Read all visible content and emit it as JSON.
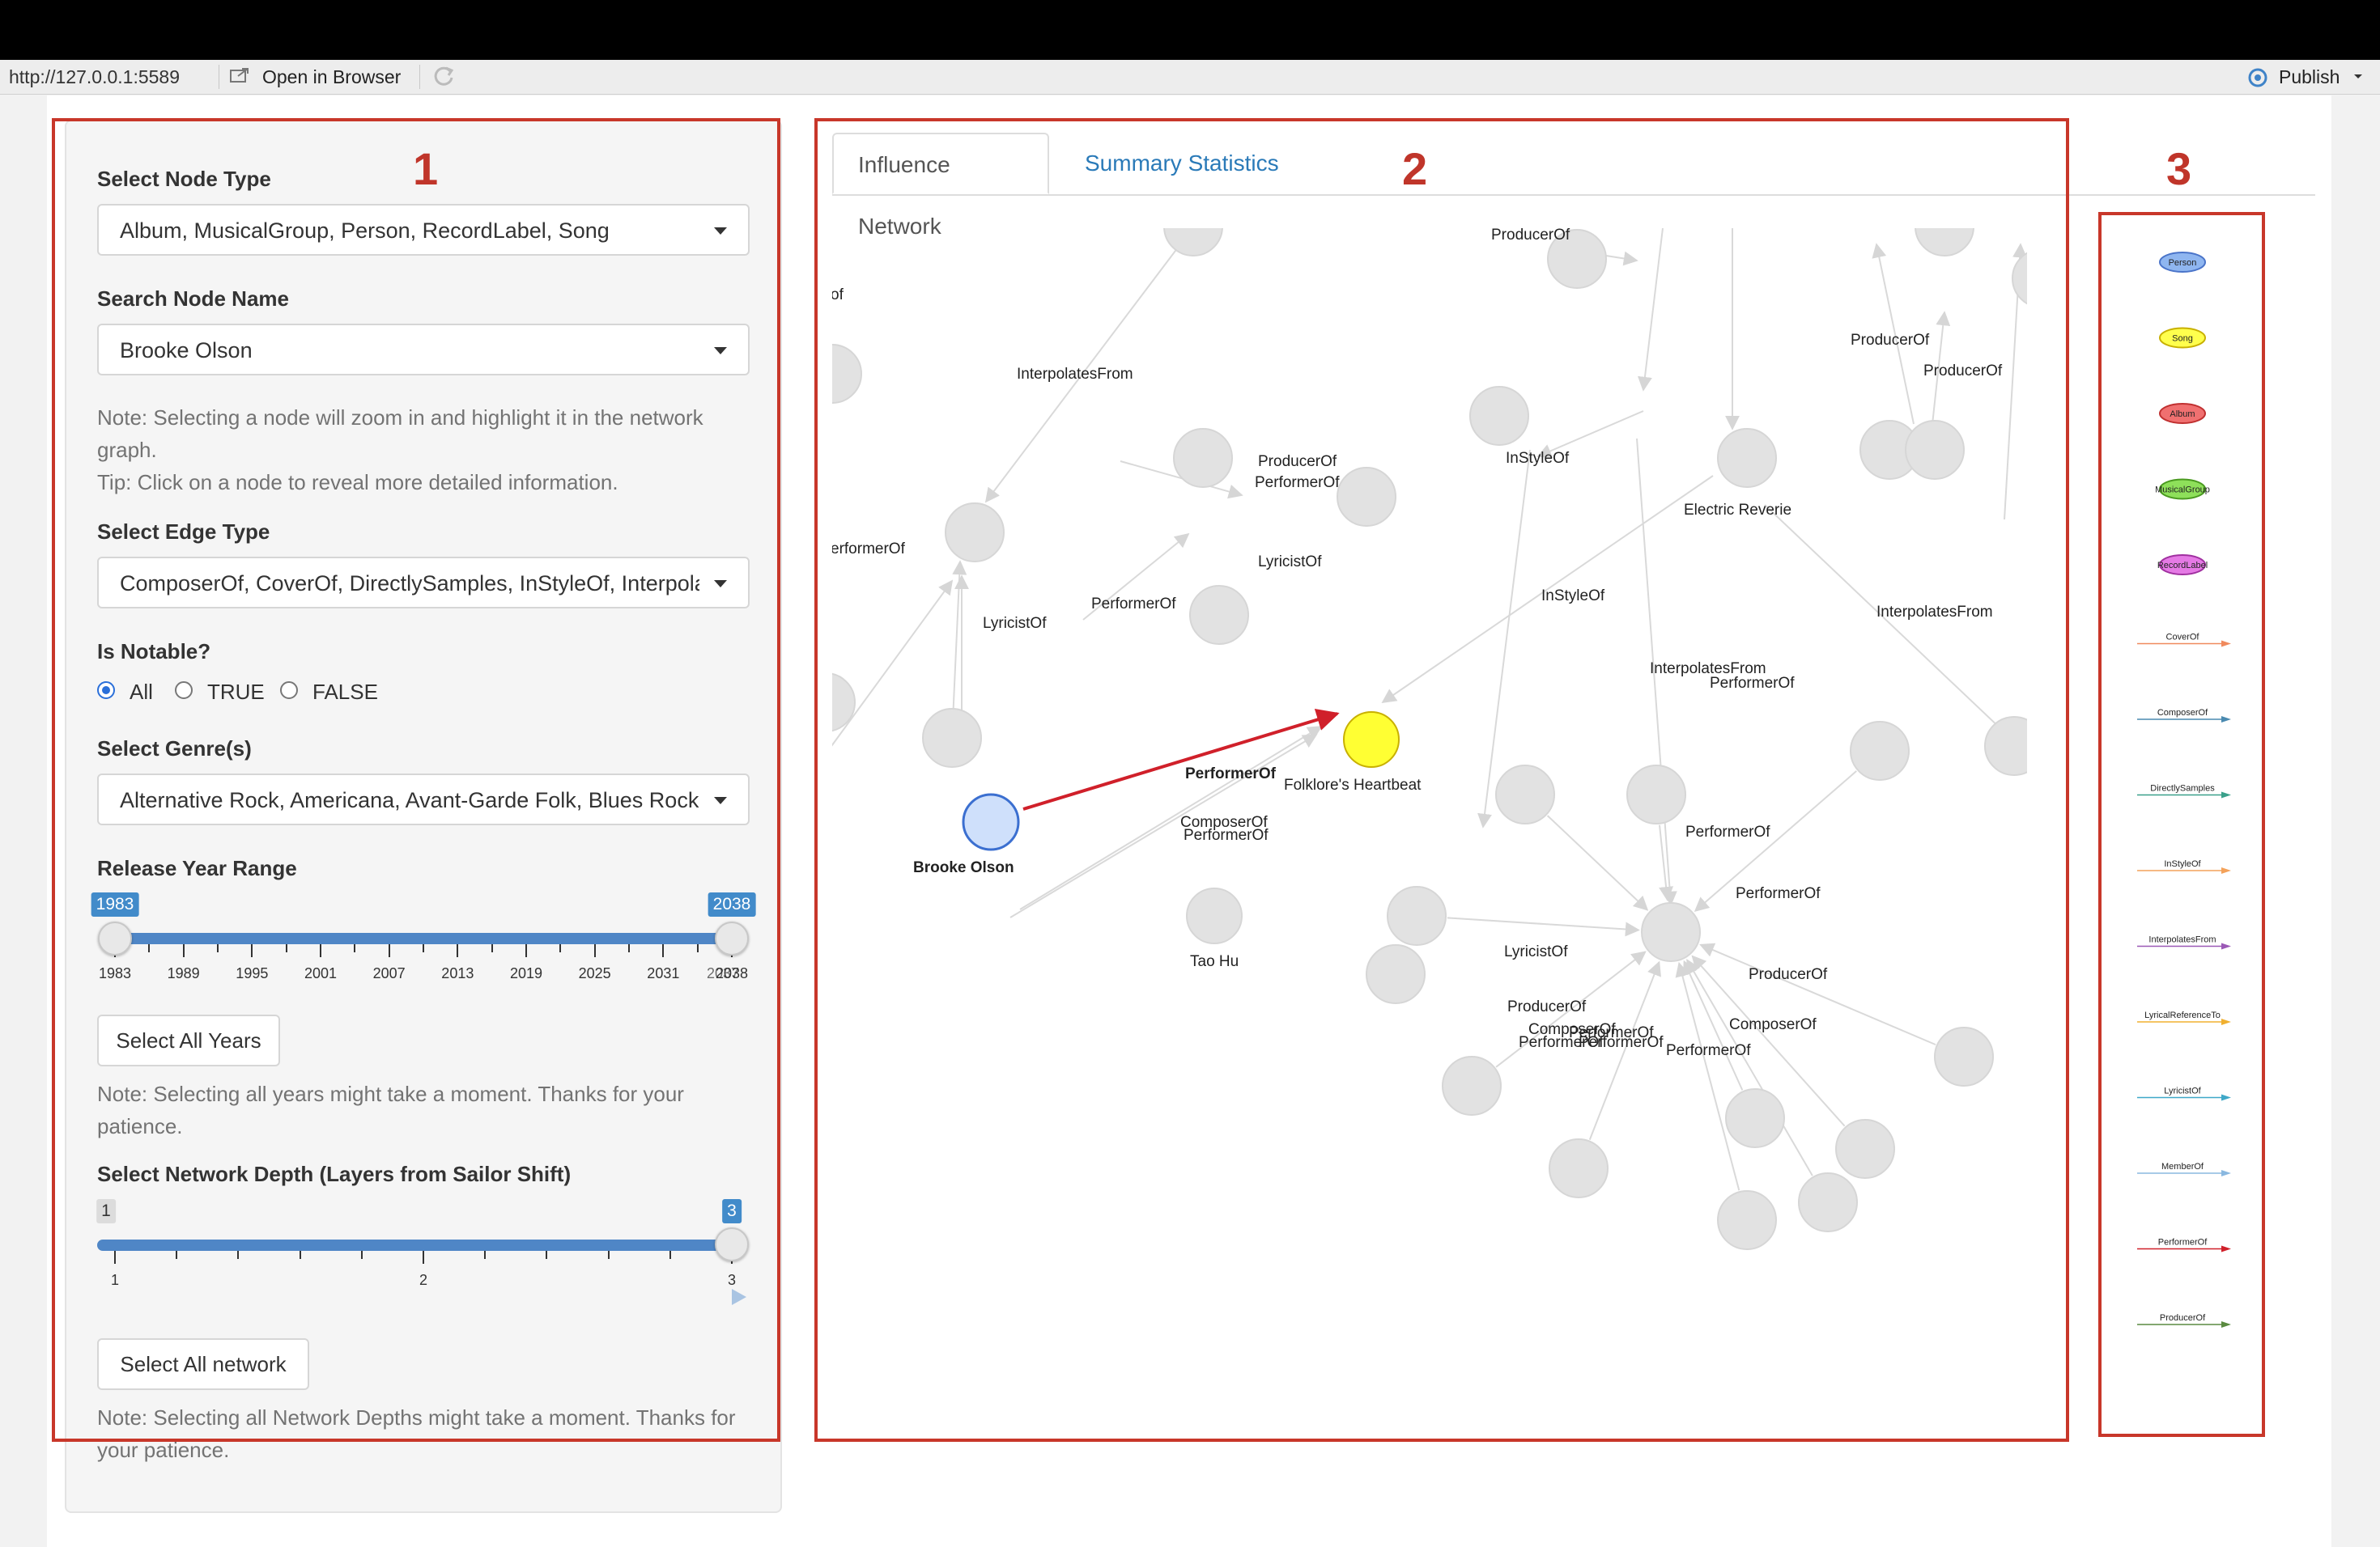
{
  "browser": {
    "url": "http://127.0.0.1:5589",
    "open_in_browser": "Open in Browser",
    "publish": "Publish"
  },
  "annotations": {
    "box1": "1",
    "box2": "2",
    "box3": "3"
  },
  "sidebar": {
    "node_type_label": "Select Node Type",
    "node_type_value": "Album, MusicalGroup, Person, RecordLabel, Song",
    "search_label": "Search Node Name",
    "search_value": "Brooke Olson",
    "note_select": "Note: Selecting a node will zoom in and highlight it in the network graph.",
    "tip_click": "Tip: Click on a node to reveal more detailed information.",
    "edge_type_label": "Select Edge Type",
    "edge_type_value": "ComposerOf, CoverOf, DirectlySamples, InStyleOf, InterpolatesFrom",
    "notable_label": "Is Notable?",
    "notable_options": [
      "All",
      "TRUE",
      "FALSE"
    ],
    "notable_selected": "All",
    "genre_label": "Select Genre(s)",
    "genre_value": "Alternative Rock, Americana, Avant-Garde Folk, Blues Rock, Doom Metal",
    "year_label": "Release Year Range",
    "year_min": "1983",
    "year_max": "2038",
    "year_ticks": [
      "1983",
      "1989",
      "1995",
      "2001",
      "2007",
      "2013",
      "2019",
      "2025",
      "2031",
      "2038"
    ],
    "year_tick_2037": "2037",
    "year_range": [
      1983,
      2038
    ],
    "select_all_years": "Select All Years",
    "note_years": "Note: Selecting all years might take a moment. Thanks for your patience.",
    "depth_label": "Select Network Depth (Layers from Sailor Shift)",
    "depth_min": "1",
    "depth_max": "3",
    "depth_ticks": [
      "1",
      "2",
      "3"
    ],
    "depth_value": 3,
    "select_all_network": "Select All network",
    "note_depth": "Note: Selecting all Network Depths might take a moment. Thanks for your patience."
  },
  "tabs": [
    {
      "label": "Influence Network",
      "active": true
    },
    {
      "label": "Summary Statistics",
      "active": false
    }
  ],
  "network": {
    "edge_labels": [
      "ProducerOf",
      "InterpolatesFrom",
      "ProducerOf",
      "ProducerOf",
      "ProducerOf",
      "PerformerOf",
      "InStyleOf",
      "Electric Reverie",
      "LyricistOf",
      "InStyleOf",
      "PerformerOf",
      "LyricistOf",
      "PerformerOf",
      "InterpolatesFrom",
      "InterpolatesFrom",
      "ComposerOf",
      "PerformerOf",
      "ComposerOf",
      "PerformerOf",
      "PerformerOf",
      "PerformerOf",
      "LyricistOf",
      "ProducerOf",
      "ProducerOf",
      "ComposerOf",
      "PerformerOf",
      "PerformerOf",
      "PerformerOf"
    ],
    "highlight_edge": "PerformerOf",
    "nodes": {
      "person": "Brooke Olson",
      "song": "Folklore's Heartbeat",
      "other": "Tao Hu"
    },
    "clipped": {
      "of": "of",
      "erformerof": "erformerOf"
    }
  },
  "legend": [
    {
      "name": "Person",
      "kind": "node",
      "color": "#8fb6f0",
      "border": "#4a74c9"
    },
    {
      "name": "Song",
      "kind": "node",
      "color": "#ffff4d",
      "border": "#c8b000"
    },
    {
      "name": "Album",
      "kind": "node",
      "color": "#f07070",
      "border": "#c03030"
    },
    {
      "name": "MusicalGroup",
      "kind": "node",
      "color": "#8ee05a",
      "border": "#4a9a20"
    },
    {
      "name": "RecordLabel",
      "kind": "node",
      "color": "#e57ae5",
      "border": "#a030a0"
    },
    {
      "name": "CoverOf",
      "kind": "edge",
      "color": "#f08a5d"
    },
    {
      "name": "ComposerOf",
      "kind": "edge",
      "color": "#4a8ab0"
    },
    {
      "name": "DirectlySamples",
      "kind": "edge",
      "color": "#3aa08a"
    },
    {
      "name": "InStyleOf",
      "kind": "edge",
      "color": "#f4a25a"
    },
    {
      "name": "InterpolatesFrom",
      "kind": "edge",
      "color": "#9b59b6"
    },
    {
      "name": "LyricalReferenceTo",
      "kind": "edge",
      "color": "#f0b030"
    },
    {
      "name": "LyricistOf",
      "kind": "edge",
      "color": "#3fa8c8"
    },
    {
      "name": "MemberOf",
      "kind": "edge",
      "color": "#8ab8e0"
    },
    {
      "name": "PerformerOf",
      "kind": "edge",
      "color": "#d0202a"
    },
    {
      "name": "ProducerOf",
      "kind": "edge",
      "color": "#5a8a40"
    }
  ]
}
